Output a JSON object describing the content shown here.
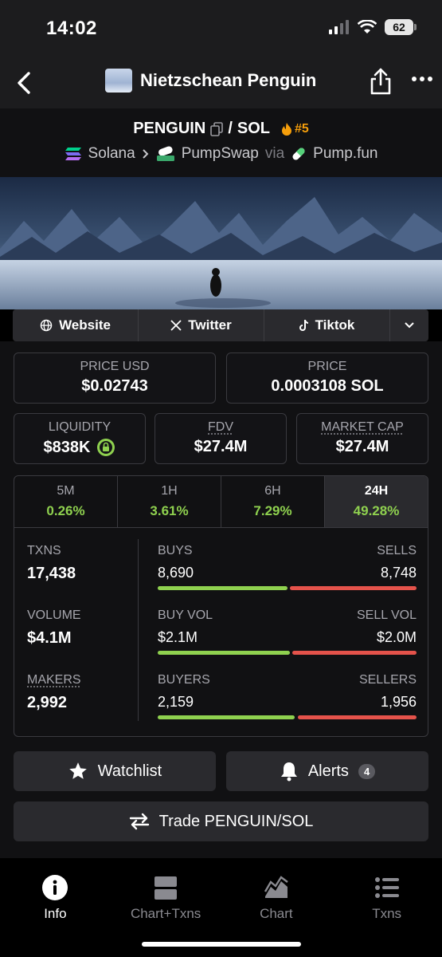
{
  "status": {
    "time": "14:02",
    "battery": "62"
  },
  "nav": {
    "title": "Nietzschean Penguin"
  },
  "pair": {
    "base": "PENGUIN",
    "separator": "/",
    "quote": "SOL",
    "rank": "#5"
  },
  "chain": {
    "network": "Solana",
    "dex": "PumpSwap",
    "via": "via",
    "launchpad": "Pump.fun"
  },
  "links": {
    "website": "Website",
    "twitter": "Twitter",
    "tiktok": "Tiktok"
  },
  "price": {
    "usd_label": "PRICE USD",
    "usd_value": "$0.02743",
    "native_label": "PRICE",
    "native_value": "0.0003108 SOL"
  },
  "metrics": {
    "liquidity_label": "LIQUIDITY",
    "liquidity_value": "$838K",
    "fdv_label": "FDV",
    "fdv_value": "$27.4M",
    "mcap_label": "MARKET CAP",
    "mcap_value": "$27.4M"
  },
  "changes": [
    {
      "period": "5M",
      "value": "0.26%"
    },
    {
      "period": "1H",
      "value": "3.61%"
    },
    {
      "period": "6H",
      "value": "7.29%"
    },
    {
      "period": "24H",
      "value": "49.28%"
    }
  ],
  "stats": {
    "txns_label": "TXNS",
    "txns_value": "17,438",
    "volume_label": "VOLUME",
    "volume_value": "$4.1M",
    "makers_label": "MAKERS",
    "makers_value": "2,992",
    "buys_label": "BUYS",
    "buys_value": "8,690",
    "sells_label": "SELLS",
    "sells_value": "8,748",
    "buy_vol_label": "BUY VOL",
    "buy_vol_value": "$2.1M",
    "sell_vol_label": "SELL VOL",
    "sell_vol_value": "$2.0M",
    "buyers_label": "BUYERS",
    "buyers_value": "2,159",
    "sellers_label": "SELLERS",
    "sellers_value": "1,956"
  },
  "actions": {
    "watchlist": "Watchlist",
    "alerts": "Alerts",
    "alerts_count": "4",
    "trade": "Trade PENGUIN/SOL"
  },
  "tabs": [
    {
      "label": "Info",
      "icon": "info-icon"
    },
    {
      "label": "Chart+Txns",
      "icon": "split-view-icon"
    },
    {
      "label": "Chart",
      "icon": "area-chart-icon"
    },
    {
      "label": "Txns",
      "icon": "list-icon"
    }
  ],
  "colors": {
    "positive": "#8fd14f",
    "negative": "#e5534b",
    "rank": "#f59e0b",
    "background": "#111113"
  }
}
